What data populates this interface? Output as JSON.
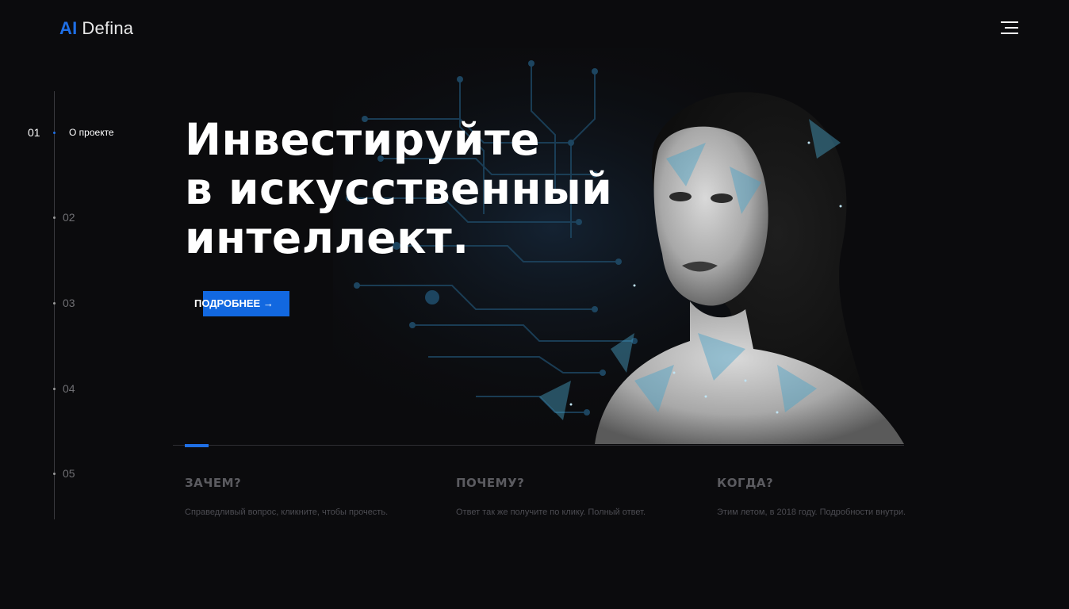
{
  "logo": {
    "ai": "AI",
    "name": "Defina"
  },
  "colors": {
    "accent": "#1f6fe5",
    "button": "#1268e0",
    "background": "#0b0b0d"
  },
  "menu": {
    "icon": "hamburger-menu-icon"
  },
  "sidenav": {
    "active": {
      "num": "01",
      "label": "О проекте"
    },
    "items": [
      "02",
      "03",
      "04",
      "05"
    ]
  },
  "hero": {
    "line1": "Инвестируйте",
    "line2": "в искусственный",
    "line3": "интеллект.",
    "cta_label": "ПОДРОБНЕЕ",
    "cta_icon": "arrow-right-icon"
  },
  "features": [
    {
      "title": "ЗАЧЕМ?",
      "desc": "Справедливый вопрос, кликните, чтобы прочесть."
    },
    {
      "title": "ПОЧЕМУ?",
      "desc": "Ответ так же получите по клику. Полный ответ."
    },
    {
      "title": "КОГДА?",
      "desc": "Этим летом, в 2018 году. Подробности внутри."
    }
  ]
}
